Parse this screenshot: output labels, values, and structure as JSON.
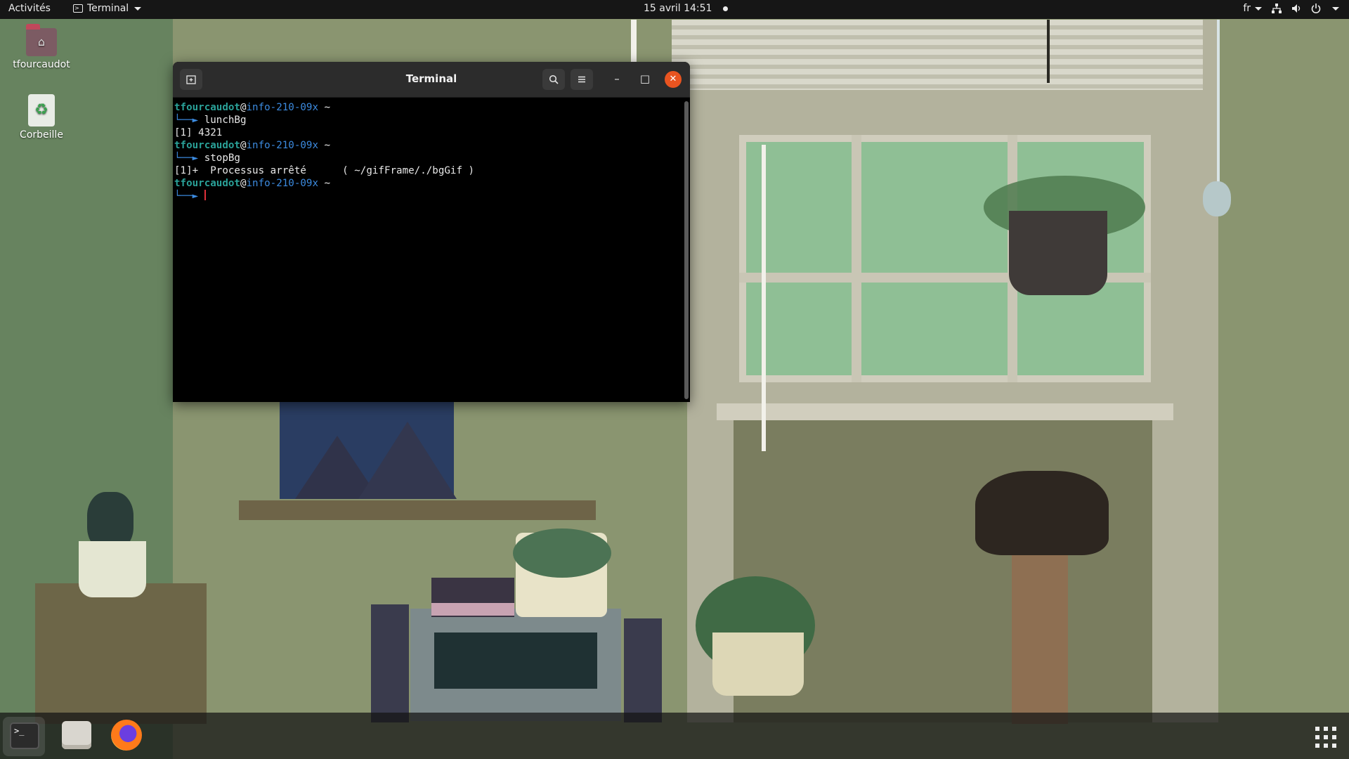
{
  "topbar": {
    "activities": "Activités",
    "app_menu": "Terminal",
    "clock": "15 avril  14:51",
    "language": "fr"
  },
  "desktop": {
    "icons": [
      {
        "label": "tfourcaudot",
        "icon": "home-folder-icon"
      },
      {
        "label": "Corbeille",
        "icon": "trash-icon"
      }
    ]
  },
  "terminal": {
    "title": "Terminal",
    "lines": [
      {
        "user": "tfourcaudot",
        "at": "@",
        "host": "info-210-09x",
        "path": " ~"
      },
      {
        "arrow": "└──► ",
        "cmd": "lunchBg"
      },
      {
        "text": "[1] 4321"
      },
      {
        "user": "tfourcaudot",
        "at": "@",
        "host": "info-210-09x",
        "path": " ~"
      },
      {
        "arrow": "└──► ",
        "cmd": "stopBg"
      },
      {
        "text": "[1]+  Processus arrêté      ( ~/gifFrame/./bgGif )"
      },
      {
        "user": "tfourcaudot",
        "at": "@",
        "host": "info-210-09x",
        "path": " ~"
      },
      {
        "arrow": "└──► ",
        "cmd": ""
      }
    ]
  },
  "dock": {
    "items": [
      {
        "name": "Terminal",
        "icon": "terminal-icon",
        "running": true
      },
      {
        "name": "Fichiers",
        "icon": "files-icon",
        "running": false
      },
      {
        "name": "Firefox",
        "icon": "firefox-icon",
        "running": false
      }
    ]
  },
  "colors": {
    "accent": "#e95420",
    "prompt_user": "#2aa198",
    "prompt_host": "#3c8be0"
  }
}
